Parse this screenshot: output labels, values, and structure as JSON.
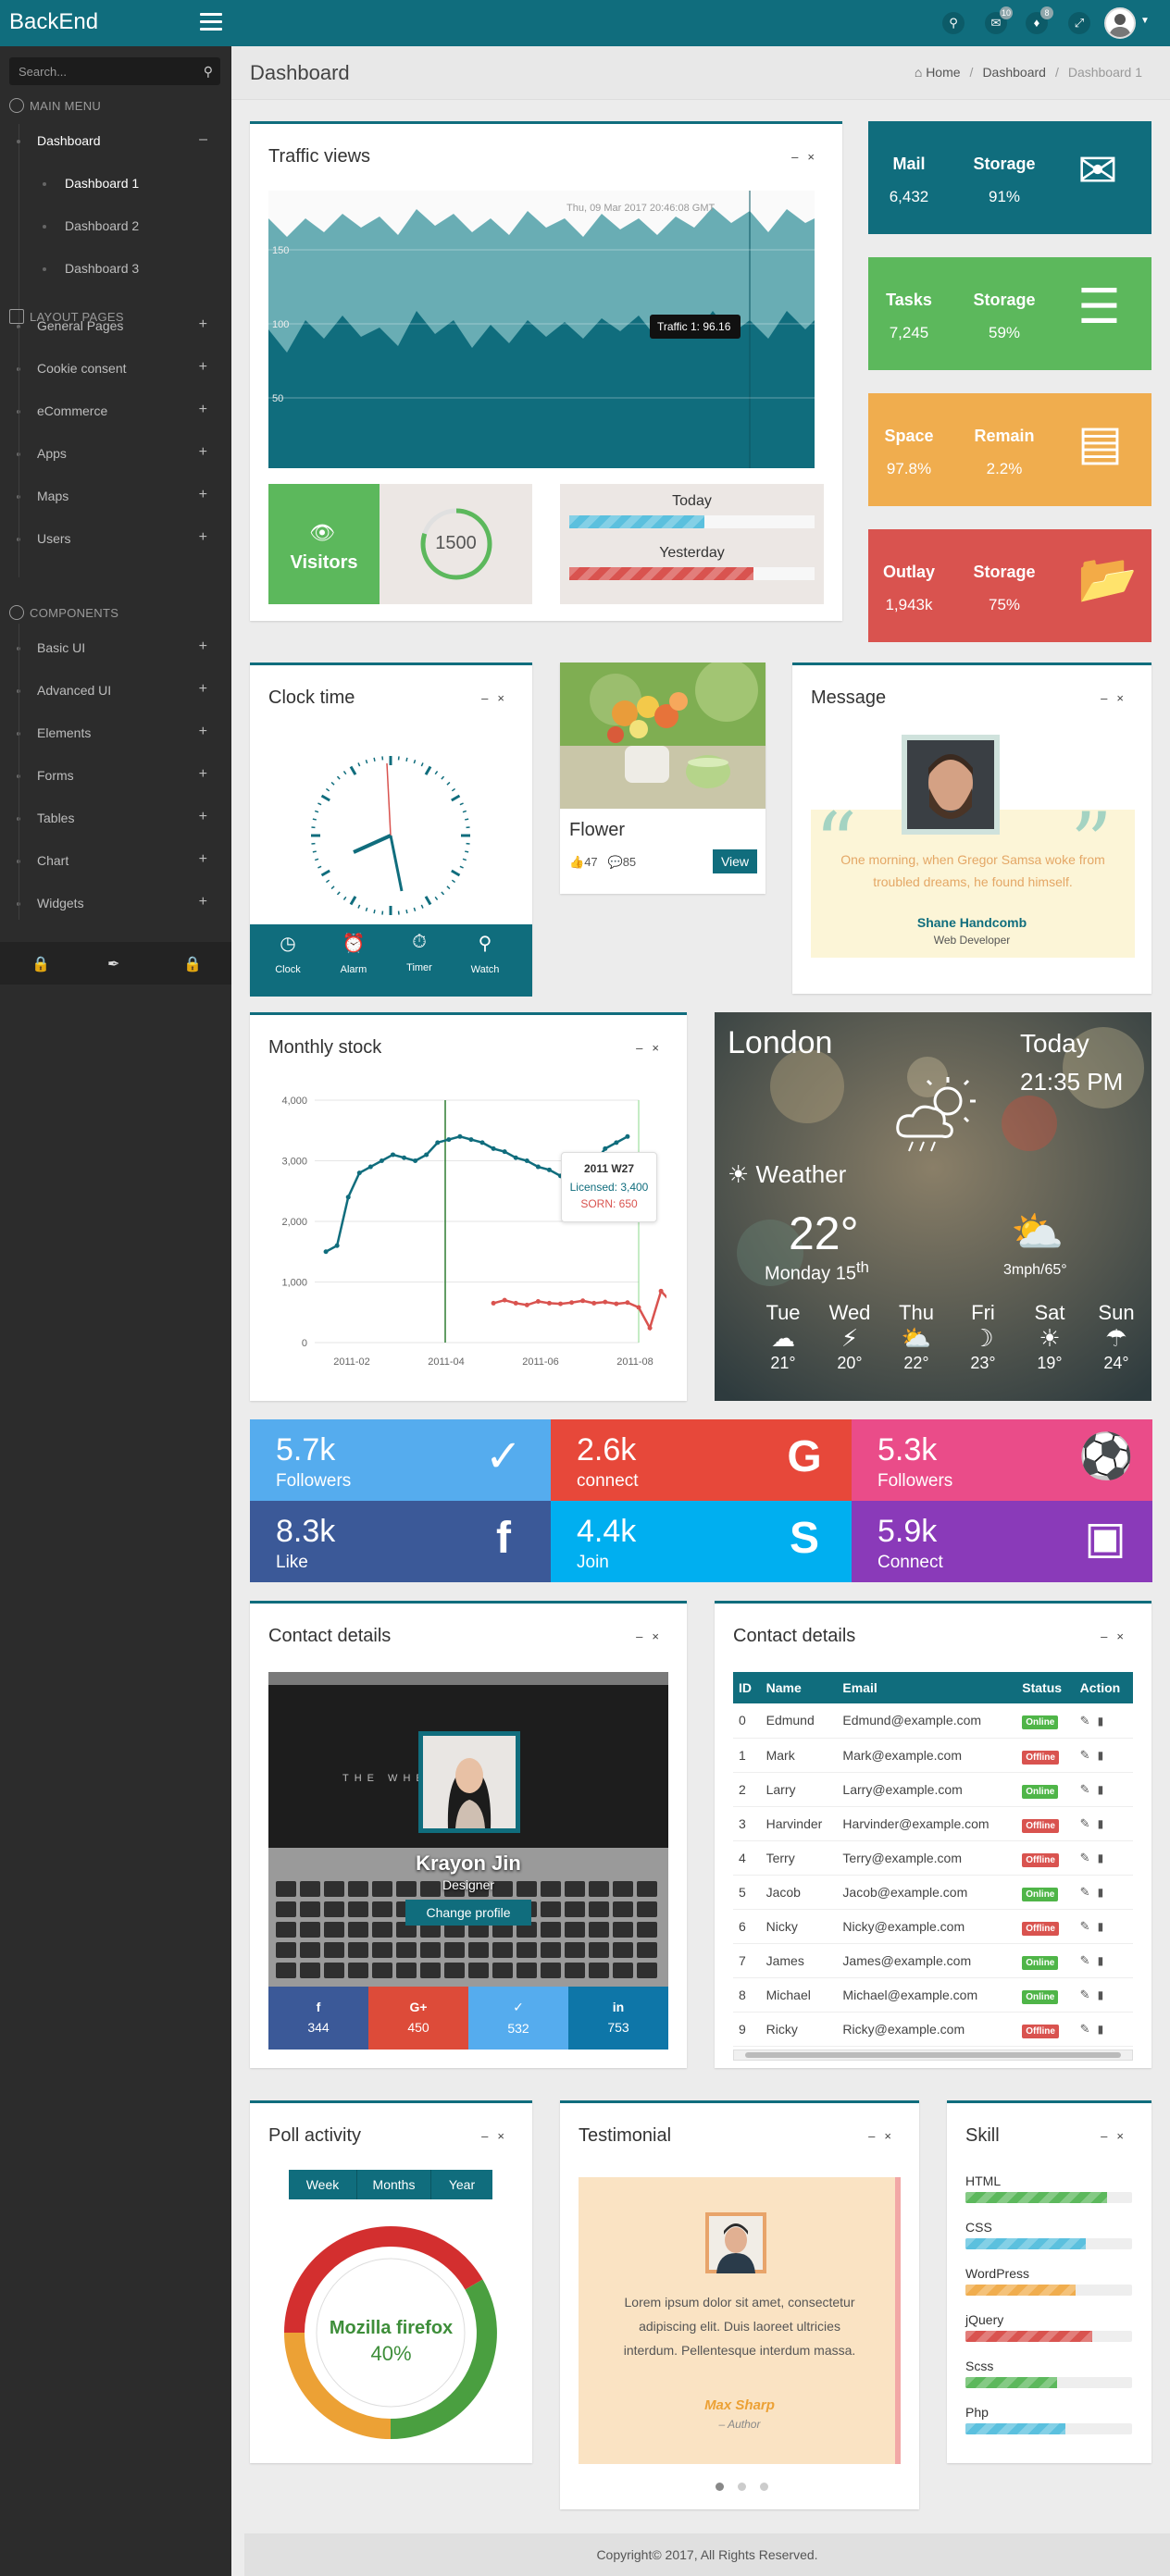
{
  "brand": {
    "logo": "BackEnd"
  },
  "topbar": {
    "mail_count": "10",
    "notif_count": "8"
  },
  "sidebar": {
    "search_placeholder": "Search...",
    "main_menu": "MAIN MENU",
    "dashboard": "Dashboard",
    "dashboard_subs": [
      "Dashboard 1",
      "Dashboard 2",
      "Dashboard 3"
    ],
    "layout_pages": "LAYOUT PAGES",
    "layout_items": [
      "General Pages",
      "Cookie consent",
      "eCommerce",
      "Apps",
      "Maps",
      "Users"
    ],
    "components": "COMPONENTS",
    "component_items": [
      "Basic UI",
      "Advanced UI",
      "Elements",
      "Forms",
      "Tables",
      "Chart",
      "Widgets"
    ]
  },
  "page": {
    "title": "Dashboard",
    "crumbs": [
      "Home",
      "Dashboard",
      "Dashboard 1"
    ]
  },
  "traffic": {
    "title": "Traffic views",
    "tooltip_date": "Thu, 09 Mar 2017 20:46:08 GMT",
    "tooltip_value": "Traffic 1: 96.16",
    "ticks": [
      "150",
      "100",
      "50"
    ],
    "visitors_label": "Visitors",
    "visitors_count": "1500",
    "visitors_progress": 0.8,
    "today_label": "Today",
    "today_progress": 0.55,
    "yesterday_label": "Yesterday",
    "yesterday_progress": 0.75
  },
  "stats": [
    {
      "t1": "Mail",
      "v1": "6,432",
      "t2": "Storage",
      "v2": "91%",
      "color": "#106d7d",
      "icon": "envelope-icon"
    },
    {
      "t1": "Tasks",
      "v1": "7,245",
      "t2": "Storage",
      "v2": "59%",
      "color": "#5cb85c",
      "icon": "server-icon"
    },
    {
      "t1": "Space",
      "v1": "97.8%",
      "t2": "Remain",
      "v2": "2.2%",
      "color": "#f0ad4e",
      "icon": "archive-box-icon"
    },
    {
      "t1": "Outlay",
      "v1": "1,943k",
      "t2": "Storage",
      "v2": "75%",
      "color": "#d9534f",
      "icon": "folder-open-icon"
    }
  ],
  "clock": {
    "title": "Clock time",
    "tabs": [
      "Clock",
      "Alarm",
      "Timer",
      "Watch"
    ]
  },
  "flower": {
    "title": "Flower",
    "likes": "47",
    "comments": "85",
    "button": "View"
  },
  "message": {
    "title": "Message",
    "quote": "One morning, when Gregor Samsa woke from troubled dreams, he found himself.",
    "name": "Shane Handcomb",
    "role": "Web Developer"
  },
  "monthly": {
    "title": "Monthly stock",
    "tooltip_title": "2011 W27",
    "tooltip_l1": "Licensed: 3,400",
    "tooltip_l2": "SORN: 650"
  },
  "chart_data": {
    "type": "line",
    "title": "Monthly stock",
    "xlabel": "",
    "ylabel": "",
    "ylim": [
      0,
      4000
    ],
    "yticks": [
      "0",
      "1,000",
      "2,000",
      "3,000",
      "4,000"
    ],
    "xticks": [
      "2011-02",
      "2011-04",
      "2011-06",
      "2011-08"
    ],
    "series": [
      {
        "name": "Licensed",
        "color": "#106d7d",
        "values": [
          1500,
          1600,
          2400,
          2800,
          2900,
          3000,
          3100,
          3050,
          3000,
          3100,
          3300,
          3350,
          3400,
          3350,
          3300,
          3200,
          3150,
          3050,
          3000,
          2900,
          2850,
          2750,
          2700,
          2800,
          2950,
          3200,
          3300,
          3400
        ]
      },
      {
        "name": "SORN",
        "color": "#d9534f",
        "start": 15,
        "values": [
          650,
          700,
          650,
          620,
          680,
          650,
          640,
          660,
          690,
          650,
          670,
          640,
          660,
          580,
          240,
          850,
          650
        ]
      }
    ]
  },
  "weather": {
    "city": "London",
    "day": "Today",
    "time": "21:35 PM",
    "label": "Weather",
    "temp": "22°",
    "date": "Monday 15",
    "date_sup": "th",
    "wind": "3mph/65°",
    "forecast": [
      {
        "d": "Tue",
        "t": "21°"
      },
      {
        "d": "Wed",
        "t": "20°"
      },
      {
        "d": "Thu",
        "t": "22°"
      },
      {
        "d": "Fri",
        "t": "23°"
      },
      {
        "d": "Sat",
        "t": "19°"
      },
      {
        "d": "Sun",
        "t": "24°"
      }
    ]
  },
  "social": [
    {
      "num": "5.7k",
      "lab": "Followers",
      "color": "#55acee",
      "icon": "twitter-icon"
    },
    {
      "num": "2.6k",
      "lab": "connect",
      "color": "#e7483a",
      "icon": "google-icon"
    },
    {
      "num": "5.3k",
      "lab": "Followers",
      "color": "#ea4c89",
      "icon": "dribbble-icon"
    },
    {
      "num": "8.3k",
      "lab": "Like",
      "color": "#3b5998",
      "icon": "facebook-icon"
    },
    {
      "num": "4.4k",
      "lab": "Join",
      "color": "#00aff0",
      "icon": "skype-icon"
    },
    {
      "num": "5.9k",
      "lab": "Connect",
      "color": "#8a3ab9",
      "icon": "instagram-icon"
    }
  ],
  "profile": {
    "title": "Contact details",
    "name": "Krayon Jin",
    "role": "Designer",
    "button": "Change profile",
    "screen_text": "THE WHERE ARE",
    "shares": [
      "344",
      "450",
      "532",
      "753"
    ]
  },
  "contacts": {
    "title": "Contact details",
    "headers": [
      "ID",
      "Name",
      "Email",
      "Status",
      "Action"
    ],
    "rows": [
      {
        "id": "0",
        "name": "Edmund",
        "email": "Edmund@example.com",
        "status": "Online"
      },
      {
        "id": "1",
        "name": "Mark",
        "email": "Mark@example.com",
        "status": "Offline"
      },
      {
        "id": "2",
        "name": "Larry",
        "email": "Larry@example.com",
        "status": "Online"
      },
      {
        "id": "3",
        "name": "Harvinder",
        "email": "Harvinder@example.com",
        "status": "Offline"
      },
      {
        "id": "4",
        "name": "Terry",
        "email": "Terry@example.com",
        "status": "Offline"
      },
      {
        "id": "5",
        "name": "Jacob",
        "email": "Jacob@example.com",
        "status": "Online"
      },
      {
        "id": "6",
        "name": "Nicky",
        "email": "Nicky@example.com",
        "status": "Offline"
      },
      {
        "id": "7",
        "name": "James",
        "email": "James@example.com",
        "status": "Online"
      },
      {
        "id": "8",
        "name": "Michael",
        "email": "Michael@example.com",
        "status": "Online"
      },
      {
        "id": "9",
        "name": "Ricky",
        "email": "Ricky@example.com",
        "status": "Offline"
      }
    ]
  },
  "poll": {
    "title": "Poll activity",
    "tabs": [
      "Week",
      "Months",
      "Year"
    ],
    "label": "Mozilla firefox",
    "percent": "40%"
  },
  "testimonial": {
    "title": "Testimonial",
    "text": "Lorem ipsum dolor sit amet, consectetur adipiscing elit. Duis laoreet ultricies interdum. Pellentesque interdum massa.",
    "name": "Max Sharp",
    "role": "– Author"
  },
  "skill": {
    "title": "Skill",
    "items": [
      {
        "name": "HTML",
        "pct": 85,
        "color": "#5cb85c"
      },
      {
        "name": "CSS",
        "pct": 72,
        "color": "#5bc0de"
      },
      {
        "name": "WordPress",
        "pct": 66,
        "color": "#f0ad4e"
      },
      {
        "name": "jQuery",
        "pct": 76,
        "color": "#d9534f"
      },
      {
        "name": "Scss",
        "pct": 55,
        "color": "#5cb85c"
      },
      {
        "name": "Php",
        "pct": 60,
        "color": "#5bc0de"
      }
    ]
  },
  "footer": {
    "text": "Copyright© 2017, All Rights Reserved."
  }
}
